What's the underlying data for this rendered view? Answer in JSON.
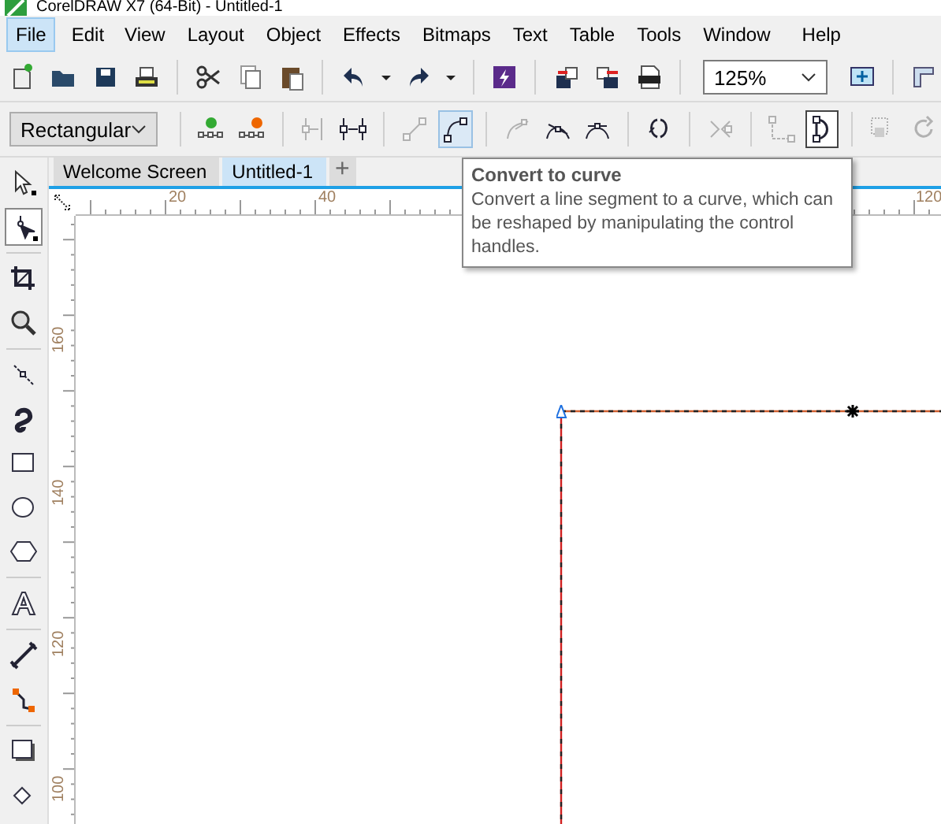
{
  "window": {
    "title": "CorelDRAW X7 (64-Bit) - Untitled-1"
  },
  "menu": [
    {
      "label": "File",
      "selected": true
    },
    {
      "label": "Edit",
      "selected": false
    },
    {
      "label": "View",
      "selected": false
    },
    {
      "label": "Layout",
      "selected": false
    },
    {
      "label": "Object",
      "selected": false
    },
    {
      "label": "Effects",
      "selected": false
    },
    {
      "label": "Bitmaps",
      "selected": false
    },
    {
      "label": "Text",
      "selected": false
    },
    {
      "label": "Table",
      "selected": false
    },
    {
      "label": "Tools",
      "selected": false
    },
    {
      "label": "Window",
      "selected": false
    },
    {
      "label": "Help",
      "selected": false
    }
  ],
  "standard_toolbar": {
    "buttons": [
      {
        "kind": "new"
      },
      {
        "kind": "open"
      },
      {
        "kind": "save"
      },
      {
        "kind": "print"
      },
      {
        "kind": "sep"
      },
      {
        "kind": "cut"
      },
      {
        "kind": "copy"
      },
      {
        "kind": "paste"
      },
      {
        "kind": "sep"
      },
      {
        "kind": "undo"
      },
      {
        "kind": "caret"
      },
      {
        "kind": "redo"
      },
      {
        "kind": "caret"
      },
      {
        "kind": "sep"
      },
      {
        "kind": "launch"
      },
      {
        "kind": "sep"
      },
      {
        "kind": "import"
      },
      {
        "kind": "export"
      },
      {
        "kind": "pdf"
      },
      {
        "kind": "sep"
      },
      {
        "kind": "zoom"
      },
      {
        "kind": "fullscreen"
      },
      {
        "kind": "sep"
      },
      {
        "kind": "rulers"
      }
    ],
    "zoom": "125%"
  },
  "property_bar": {
    "mode": "Rectangular",
    "buttons": [
      {
        "kind": "sep"
      },
      {
        "kind": "add-node",
        "disabled": false,
        "selected": false
      },
      {
        "kind": "delete-node",
        "disabled": false,
        "selected": false
      },
      {
        "kind": "sep"
      },
      {
        "kind": "join",
        "disabled": true,
        "selected": false
      },
      {
        "kind": "break",
        "disabled": false,
        "selected": false
      },
      {
        "kind": "sep"
      },
      {
        "kind": "to-line",
        "disabled": true,
        "selected": false
      },
      {
        "kind": "to-curve",
        "disabled": false,
        "selected": true
      },
      {
        "kind": "sep"
      },
      {
        "kind": "cusp",
        "disabled": true,
        "selected": false
      },
      {
        "kind": "smooth",
        "disabled": false,
        "selected": false
      },
      {
        "kind": "symmetric",
        "disabled": false,
        "selected": false
      },
      {
        "kind": "sep"
      },
      {
        "kind": "reverse",
        "disabled": false,
        "selected": false
      },
      {
        "kind": "sep"
      },
      {
        "kind": "extend",
        "disabled": true,
        "selected": false
      },
      {
        "kind": "sep"
      },
      {
        "kind": "extract",
        "disabled": true,
        "selected": false
      },
      {
        "kind": "close",
        "disabled": false,
        "selected": true
      },
      {
        "kind": "sep"
      },
      {
        "kind": "stretch",
        "disabled": true,
        "selected": false
      },
      {
        "kind": "rotate",
        "disabled": true,
        "selected": false
      }
    ]
  },
  "document_tabs": [
    {
      "label": "Welcome Screen",
      "selected": false
    },
    {
      "label": "Untitled-1",
      "selected": true
    }
  ],
  "new_tab": "+",
  "tooltip": {
    "title": "Convert to curve",
    "text": "Convert a line segment to a curve, which can be reshaped by manipulating the control handles."
  },
  "horizontal_ruler": {
    "labels": [
      "20",
      "40",
      "120"
    ]
  },
  "vertical_ruler": {
    "labels": [
      "160",
      "140",
      "120",
      "100"
    ]
  },
  "toolbox": [
    {
      "kind": "pick",
      "selected": false
    },
    {
      "kind": "shape",
      "selected": true
    },
    {
      "kind": "sep"
    },
    {
      "kind": "crop",
      "selected": false
    },
    {
      "kind": "zoom",
      "selected": false
    },
    {
      "kind": "sep"
    },
    {
      "kind": "freehand",
      "selected": false
    },
    {
      "kind": "artistic",
      "selected": false
    },
    {
      "kind": "rectangle",
      "selected": false
    },
    {
      "kind": "ellipse",
      "selected": false
    },
    {
      "kind": "polygon",
      "selected": false
    },
    {
      "kind": "sep"
    },
    {
      "kind": "text",
      "selected": false
    },
    {
      "kind": "sep"
    },
    {
      "kind": "dimension",
      "selected": false
    },
    {
      "kind": "connector",
      "selected": false
    },
    {
      "kind": "sep"
    },
    {
      "kind": "shadow",
      "selected": false
    },
    {
      "kind": "fill",
      "selected": false
    }
  ]
}
